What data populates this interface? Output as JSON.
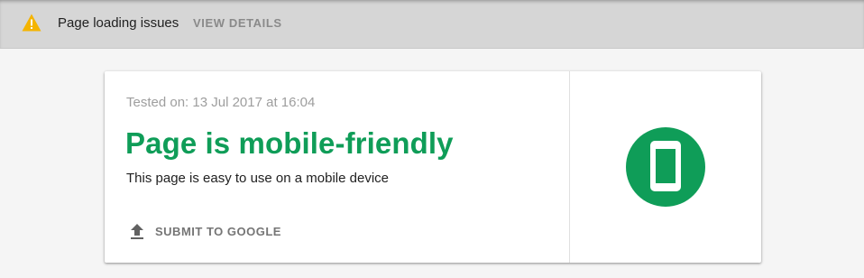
{
  "warning_bar": {
    "icon": "warning-icon",
    "message": "Page loading issues",
    "action_label": "VIEW DETAILS",
    "icon_color": "#f4b400"
  },
  "result": {
    "tested_on": "Tested on: 13 Jul 2017 at 16:04",
    "title": "Page is mobile-friendly",
    "description": "This page is easy to use on a mobile device",
    "submit_label": "SUBMIT TO GOOGLE",
    "submit_icon": "upload-icon",
    "badge_icon": "mobile-phone-icon",
    "status_color": "#0f9d58"
  }
}
